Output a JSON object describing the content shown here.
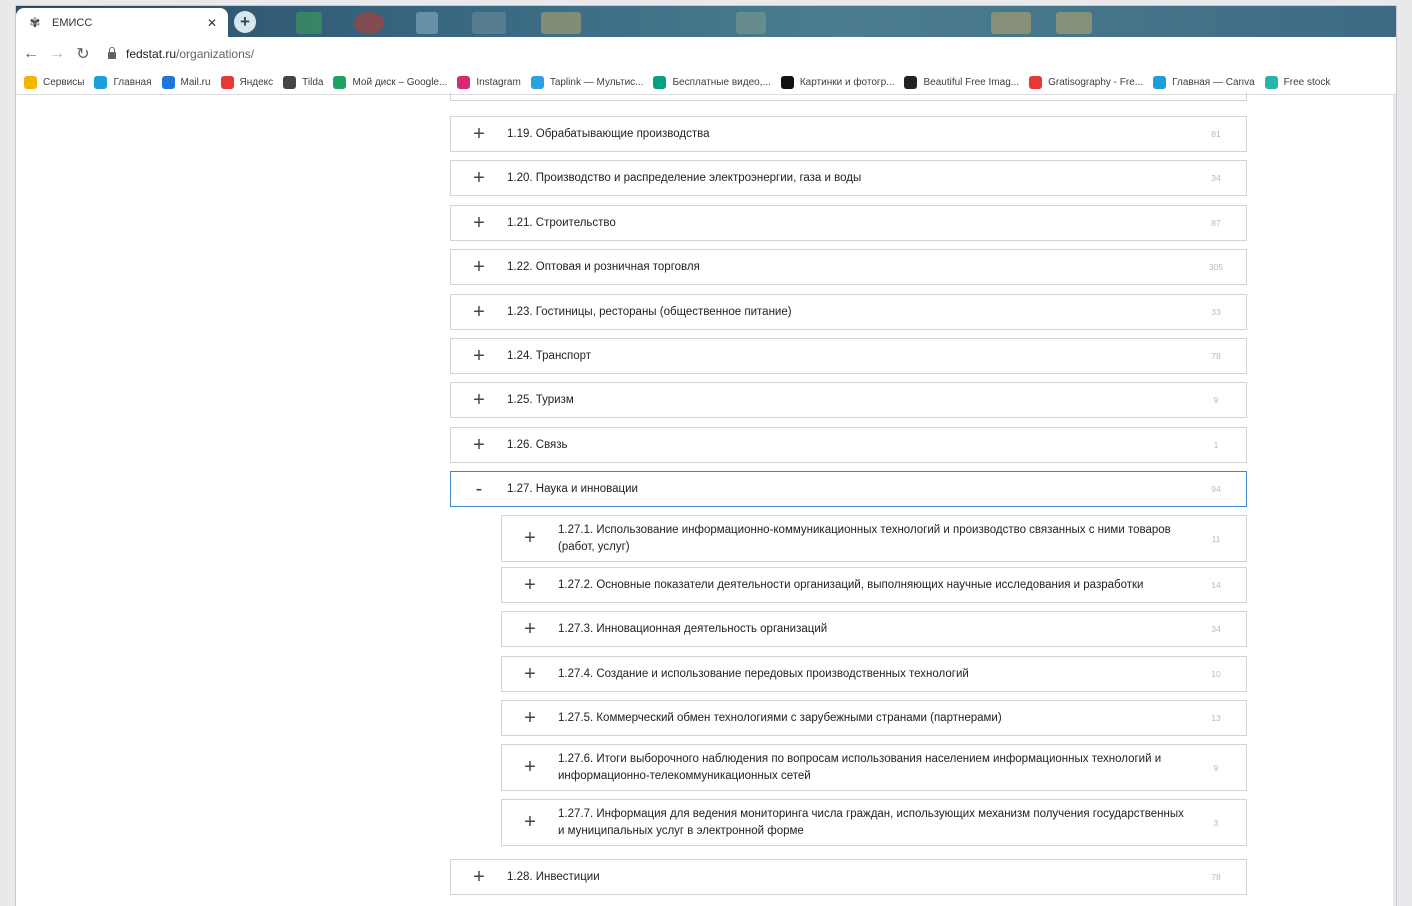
{
  "browser": {
    "tab": {
      "title": "ЕМИСС"
    },
    "url": {
      "host": "fedstat.ru",
      "path": "/organizations/"
    },
    "bookmarks": [
      {
        "label": "Сервисы",
        "icon": "apps-grid-icon",
        "color": "#f4b400"
      },
      {
        "label": "Главная",
        "icon": "canva-icon",
        "color": "#1a9fd8"
      },
      {
        "label": "Mail.ru",
        "icon": "mailru-icon",
        "color": "#1f75d8"
      },
      {
        "label": "Яндекс",
        "icon": "yandex-icon",
        "color": "#e53935"
      },
      {
        "label": "Tilda",
        "icon": "tilda-icon",
        "color": "#444444"
      },
      {
        "label": "Мой диск – Google...",
        "icon": "google-drive-icon",
        "color": "#1ea362"
      },
      {
        "label": "Instagram",
        "icon": "instagram-icon",
        "color": "#d62976"
      },
      {
        "label": "Taplink — Мультис...",
        "icon": "taplink-icon",
        "color": "#29a3e0"
      },
      {
        "label": "Бесплатные видео,...",
        "icon": "pexels-icon",
        "color": "#05a081"
      },
      {
        "label": "Картинки и фотогр...",
        "icon": "unsplash-icon",
        "color": "#111111"
      },
      {
        "label": "Beautiful Free Imag...",
        "icon": "free-images-icon",
        "color": "#222222"
      },
      {
        "label": "Gratisography - Fre...",
        "icon": "gratisography-icon",
        "color": "#e53935"
      },
      {
        "label": "Главная — Canva",
        "icon": "canva-icon",
        "color": "#1a9fd8"
      },
      {
        "label": "Free stock",
        "icon": "free-stock-icon",
        "color": "#26b5a8"
      }
    ]
  },
  "categories": [
    {
      "label": "1.19. Обрабатывающие производства",
      "count": "81",
      "state": "collapsed",
      "level": 1
    },
    {
      "label": "1.20. Производство и распределение электроэнергии, газа и воды",
      "count": "34",
      "state": "collapsed",
      "level": 1
    },
    {
      "label": "1.21. Строительство",
      "count": "87",
      "state": "collapsed",
      "level": 1
    },
    {
      "label": "1.22. Оптовая и розничная торговля",
      "count": "305",
      "state": "collapsed",
      "level": 1
    },
    {
      "label": "1.23. Гостиницы, рестораны (общественное питание)",
      "count": "33",
      "state": "collapsed",
      "level": 1
    },
    {
      "label": "1.24. Транспорт",
      "count": "78",
      "state": "collapsed",
      "level": 1
    },
    {
      "label": "1.25. Туризм",
      "count": "9",
      "state": "collapsed",
      "level": 1
    },
    {
      "label": "1.26. Связь",
      "count": "1",
      "state": "collapsed",
      "level": 1
    },
    {
      "label": "1.27. Наука и инновации",
      "count": "94",
      "state": "expanded",
      "level": 1
    },
    {
      "label": "1.27.1. Использование информационно-коммуникационных технологий и производство связанных с ними товаров (работ, услуг)",
      "count": "11",
      "state": "collapsed",
      "level": 2
    },
    {
      "label": "1.27.2. Основные показатели деятельности организаций, выполняющих научные исследования и разработки",
      "count": "14",
      "state": "collapsed",
      "level": 2
    },
    {
      "label": "1.27.3. Инновационная деятельность организаций",
      "count": "34",
      "state": "collapsed",
      "level": 2
    },
    {
      "label": "1.27.4. Создание и использование передовых производственных технологий",
      "count": "10",
      "state": "collapsed",
      "level": 2
    },
    {
      "label": "1.27.5. Коммерческий обмен технологиями с зарубежными странами (партнерами)",
      "count": "13",
      "state": "collapsed",
      "level": 2
    },
    {
      "label": "1.27.6. Итоги выборочного наблюдения по вопросам использования населением информационных технологий и информационно-телекоммуникационных сетей",
      "count": "9",
      "state": "collapsed",
      "level": 2
    },
    {
      "label": "1.27.7. Информация для ведения мониторинга числа граждан, использующих механизм получения государственных и муниципальных услуг в электронной форме",
      "count": "3",
      "state": "collapsed",
      "level": 2
    },
    {
      "label": "1.28. Инвестиции",
      "count": "78",
      "state": "collapsed",
      "level": 1
    }
  ],
  "toggle_symbols": {
    "collapsed": "+",
    "expanded": "-"
  },
  "colors": {
    "expanded_border": "#3d86c9",
    "row_border": "#d4d4d4",
    "count_text": "#b8b8b8"
  }
}
